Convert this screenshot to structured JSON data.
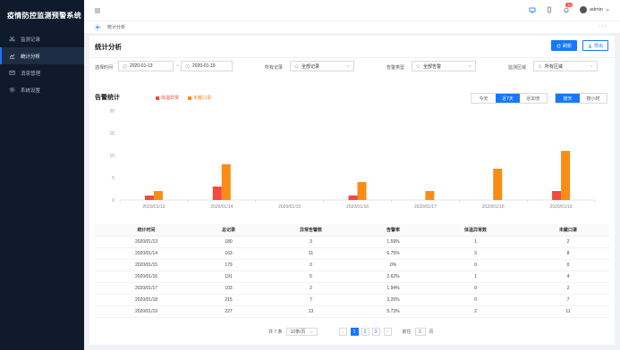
{
  "app_title": "疫情防控监测预警系统",
  "sidebar": {
    "items": [
      {
        "label": "监测记录",
        "icon": "scissors-icon",
        "active": false
      },
      {
        "label": "统计分析",
        "icon": "chart-line-icon",
        "active": true
      },
      {
        "label": "消息管理",
        "icon": "mail-icon",
        "active": false
      },
      {
        "label": "系统设置",
        "icon": "gear-icon",
        "active": false
      }
    ]
  },
  "header": {
    "notification_count": "10",
    "user_name": "admin"
  },
  "tabbar": {
    "tab_label": "统计分析",
    "more": "···"
  },
  "page": {
    "title": "统计分析",
    "refresh_label": "刷新",
    "export_label": "导出"
  },
  "filters": {
    "time_label": "选择时间",
    "date_start": "2020-01-13",
    "date_end": "2020-01-19",
    "dash": "~",
    "record_label": "所有记录",
    "record_value": "全部记录",
    "type_label": "告警类型",
    "type_value": "全部告警",
    "area_label": "监测区域",
    "area_value": "所有区域"
  },
  "chart_section": {
    "title": "告警统计",
    "legend": [
      "体温异常",
      "未戴口罩"
    ],
    "range_buttons": [
      "今天",
      "近7天",
      "近30天"
    ],
    "range_active": 1,
    "unit_buttons": [
      "按天",
      "按小时"
    ],
    "unit_active": 0
  },
  "chart_data": {
    "type": "bar",
    "categories": [
      "2020/01/13",
      "2020/01/14",
      "2020/01/15",
      "2020/01/16",
      "2020/01/17",
      "2020/01/18",
      "2020/01/19"
    ],
    "series": [
      {
        "name": "体温异常",
        "values": [
          1,
          3,
          0,
          1,
          0,
          0,
          2
        ],
        "color": "#f5483f"
      },
      {
        "name": "未戴口罩",
        "values": [
          2,
          8,
          0,
          4,
          2,
          7,
          11
        ],
        "color": "#fa8c16"
      }
    ],
    "yticks": [
      0,
      5,
      10,
      15,
      20
    ],
    "ylim": [
      0,
      20
    ],
    "grid": false
  },
  "table": {
    "headers": [
      "统计时间",
      "总记录",
      "异常告警数",
      "告警率",
      "体温异常数",
      "未戴口罩"
    ],
    "rows": [
      [
        "2020/01/13",
        "180",
        "3",
        "1.59%",
        "1",
        "2"
      ],
      [
        "2020/01/14",
        "163",
        "11",
        "6.75%",
        "3",
        "8"
      ],
      [
        "2020/01/15",
        "179",
        "0",
        "0%",
        "0",
        "0"
      ],
      [
        "2020/01/16",
        "191",
        "5",
        "2.62%",
        "1",
        "4"
      ],
      [
        "2020/01/17",
        "103",
        "2",
        "1.94%",
        "0",
        "2"
      ],
      [
        "2020/01/18",
        "215",
        "7",
        "3.26%",
        "0",
        "7"
      ],
      [
        "2020/01/19",
        "227",
        "13",
        "5.73%",
        "2",
        "11"
      ]
    ]
  },
  "pagination": {
    "total": "共 7 条",
    "page_size": "10条/页",
    "prev": "‹",
    "pages": [
      "1",
      "2",
      "3"
    ],
    "active_page": 0,
    "next": "›",
    "goto_label": "前往",
    "goto_value": "1",
    "goto_suffix": "页"
  }
}
